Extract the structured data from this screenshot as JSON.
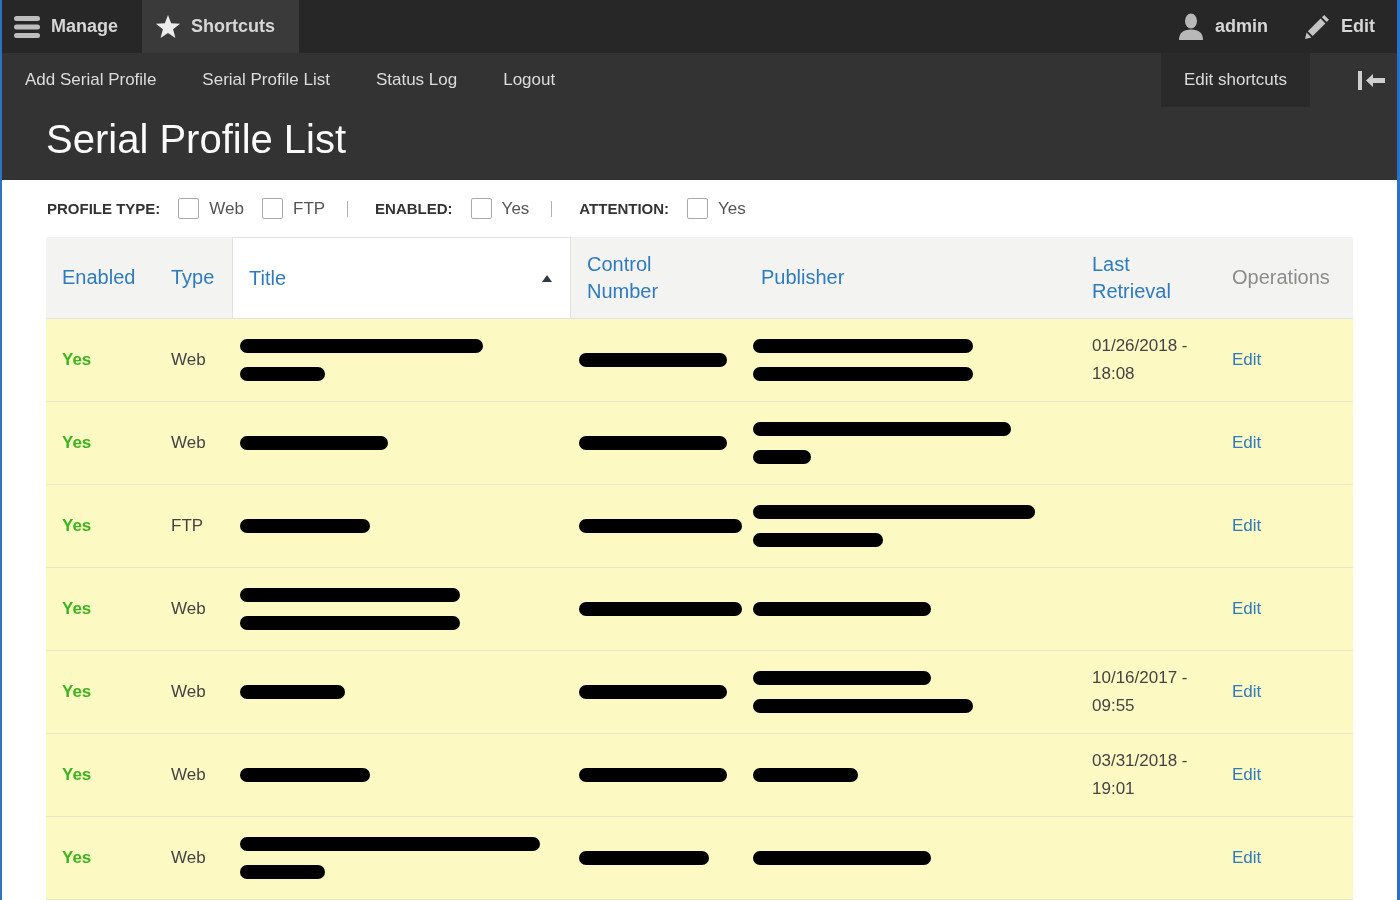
{
  "toolbar": {
    "items": [
      {
        "label": "Manage",
        "selected": false
      },
      {
        "label": "Shortcuts",
        "selected": true
      }
    ],
    "user": {
      "label": "admin"
    },
    "edit": {
      "label": "Edit"
    }
  },
  "tray": {
    "links": [
      "Add Serial Profile",
      "Serial Profile List",
      "Status Log",
      "Logout"
    ],
    "edit_shortcuts": "Edit shortcuts"
  },
  "page_title": "Serial Profile List",
  "filters": [
    {
      "label": "PROFILE TYPE:",
      "options": [
        {
          "label": "Web",
          "checked": false
        },
        {
          "label": "FTP",
          "checked": false
        }
      ]
    },
    {
      "label": "ENABLED:",
      "options": [
        {
          "label": "Yes",
          "checked": false
        }
      ]
    },
    {
      "label": "ATTENTION:",
      "options": [
        {
          "label": "Yes",
          "checked": false
        }
      ]
    }
  ],
  "table": {
    "columns": [
      {
        "label": "Enabled",
        "sortable": true,
        "sorted": false
      },
      {
        "label": "Type",
        "sortable": true,
        "sorted": false
      },
      {
        "label": "Title",
        "sortable": true,
        "sorted": true
      },
      {
        "label": "Control Number",
        "sortable": true,
        "sorted": false
      },
      {
        "label": "Publisher",
        "sortable": true,
        "sorted": false
      },
      {
        "label": "Last Retrieval",
        "sortable": true,
        "sorted": false
      },
      {
        "label": "Operations",
        "sortable": false,
        "sorted": false
      }
    ],
    "rows": [
      {
        "highlighted": true,
        "enabled": "Yes",
        "type": "Web",
        "title": {
          "redactions": [
            {
              "kind": "huge"
            },
            {
              "kind": "short"
            }
          ]
        },
        "control_number": {
          "redactions": [
            {
              "kind": "standard"
            }
          ]
        },
        "publisher": {
          "redactions": [
            {
              "kind": "broad"
            },
            {
              "kind": "broad"
            }
          ]
        },
        "last_retrieval": "01/26/2018 - 18:08",
        "operation": "Edit"
      },
      {
        "highlighted": true,
        "enabled": "Yes",
        "type": "Web",
        "title": {
          "redactions": [
            {
              "kind": "standard"
            }
          ]
        },
        "control_number": {
          "redactions": [
            {
              "kind": "standard"
            }
          ]
        },
        "publisher": {
          "redactions": [
            {
              "kind": "vast"
            },
            {
              "kind": "tiny"
            }
          ]
        },
        "operation": "Edit"
      },
      {
        "highlighted": true,
        "enabled": "Yes",
        "type": "FTP",
        "title": {
          "redactions": [
            {
              "kind": "medium"
            }
          ]
        },
        "control_number": {
          "redactions": [
            {
              "kind": "long"
            }
          ]
        },
        "publisher": {
          "redactions": [
            {
              "kind": "full"
            },
            {
              "kind": "medium"
            }
          ]
        },
        "operation": "Edit"
      },
      {
        "highlighted": true,
        "enabled": "Yes",
        "type": "Web",
        "title": {
          "redactions": [
            {
              "kind": "broad"
            },
            {
              "kind": "broad"
            }
          ]
        },
        "control_number": {
          "redactions": [
            {
              "kind": "long"
            }
          ]
        },
        "publisher": {
          "redactions": [
            {
              "kind": "wide"
            }
          ]
        },
        "operation": "Edit"
      },
      {
        "highlighted": true,
        "enabled": "Yes",
        "type": "Web",
        "title": {
          "redactions": [
            {
              "kind": "compact"
            }
          ]
        },
        "control_number": {
          "redactions": [
            {
              "kind": "standard"
            }
          ]
        },
        "publisher": {
          "redactions": [
            {
              "kind": "wide"
            },
            {
              "kind": "broad"
            }
          ]
        },
        "last_retrieval": "10/16/2017 - 09:55",
        "operation": "Edit"
      },
      {
        "highlighted": true,
        "enabled": "Yes",
        "type": "Web",
        "title": {
          "redactions": [
            {
              "kind": "medium"
            }
          ]
        },
        "control_number": {
          "redactions": [
            {
              "kind": "standard"
            }
          ]
        },
        "publisher": {
          "redactions": [
            {
              "kind": "compact"
            }
          ]
        },
        "last_retrieval": "03/31/2018 - 19:01",
        "operation": "Edit"
      },
      {
        "highlighted": true,
        "enabled": "Yes",
        "type": "Web",
        "title": {
          "redactions": [
            {
              "kind": "span"
            },
            {
              "kind": "short"
            }
          ]
        },
        "control_number": {
          "redactions": [
            {
              "kind": "medium"
            }
          ]
        },
        "publisher": {
          "redactions": [
            {
              "kind": "wide"
            }
          ]
        },
        "operation": "Edit"
      }
    ]
  }
}
